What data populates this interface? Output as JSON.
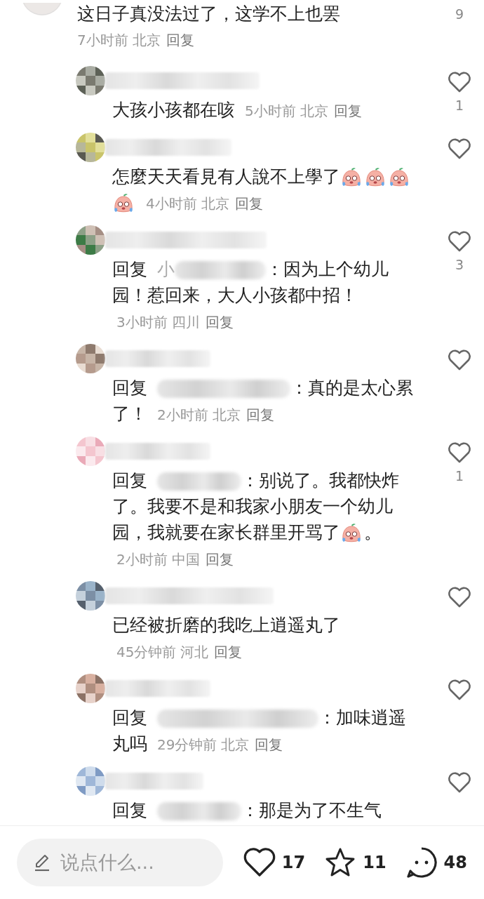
{
  "top_comment": {
    "text": "这日子真没法过了，这学不上也罢",
    "time": "7小时前",
    "location": "北京",
    "reply": "回复",
    "like_count": "9"
  },
  "replies": [
    {
      "kind": "comment",
      "body": [
        {
          "kind": "text",
          "text": "大孩小孩都在咳"
        }
      ],
      "time": "5小时前",
      "location": "北京",
      "reply": "回复",
      "like_count": "1"
    },
    {
      "kind": "comment",
      "body": [
        {
          "kind": "text",
          "text": "怎麼天天看見有人說不上學了"
        },
        {
          "kind": "emoji"
        },
        {
          "kind": "emoji"
        },
        {
          "kind": "emoji"
        },
        {
          "kind": "emoji"
        }
      ],
      "time": "4小时前",
      "location": "北京",
      "reply": "回复"
    },
    {
      "kind": "reply",
      "reply_label": "回复",
      "mention_shown": "小",
      "body": [
        {
          "kind": "text",
          "text": "：因为上个幼儿"
        },
        {
          "kind": "text",
          "text": "园！惹回来，大人小孩都中招！"
        }
      ],
      "time": "3小时前",
      "location": "四川",
      "reply": "回复",
      "like_count": "3"
    },
    {
      "kind": "reply",
      "reply_label": "回复",
      "body": [
        {
          "kind": "text",
          "text": "：真的是太心累"
        },
        {
          "kind": "text",
          "text": "了！"
        }
      ],
      "time": "2小时前",
      "location": "北京",
      "reply": "回复"
    },
    {
      "kind": "reply",
      "reply_label": "回复",
      "body": [
        {
          "kind": "text",
          "text": "：别说了。我都快炸"
        },
        {
          "kind": "text",
          "text": "了。我要不是和我家小朋友一个幼儿"
        },
        {
          "kind": "text",
          "text": "园，我就要在家长群里开骂了"
        },
        {
          "kind": "emoji"
        },
        {
          "kind": "text",
          "text": "。"
        }
      ],
      "time": "2小时前",
      "location": "中国",
      "reply": "回复",
      "like_count": "1"
    },
    {
      "kind": "comment",
      "body": [
        {
          "kind": "text",
          "text": "已经被折磨的我吃上逍遥丸了"
        }
      ],
      "time": "45分钟前",
      "location": "河北",
      "reply": "回复"
    },
    {
      "kind": "reply",
      "reply_label": "回复",
      "body": [
        {
          "kind": "text",
          "text": "：加味逍遥"
        },
        {
          "kind": "text",
          "text": "丸吗"
        }
      ],
      "time": "29分钟前",
      "location": "北京",
      "reply": "回复"
    },
    {
      "kind": "reply",
      "reply_label": "回复",
      "body": [
        {
          "kind": "text",
          "text": "：那是为了不生气"
        }
      ]
    }
  ],
  "bottom_bar": {
    "placeholder": "说点什么...",
    "likes": "17",
    "favorites": "11",
    "comments": "48"
  }
}
